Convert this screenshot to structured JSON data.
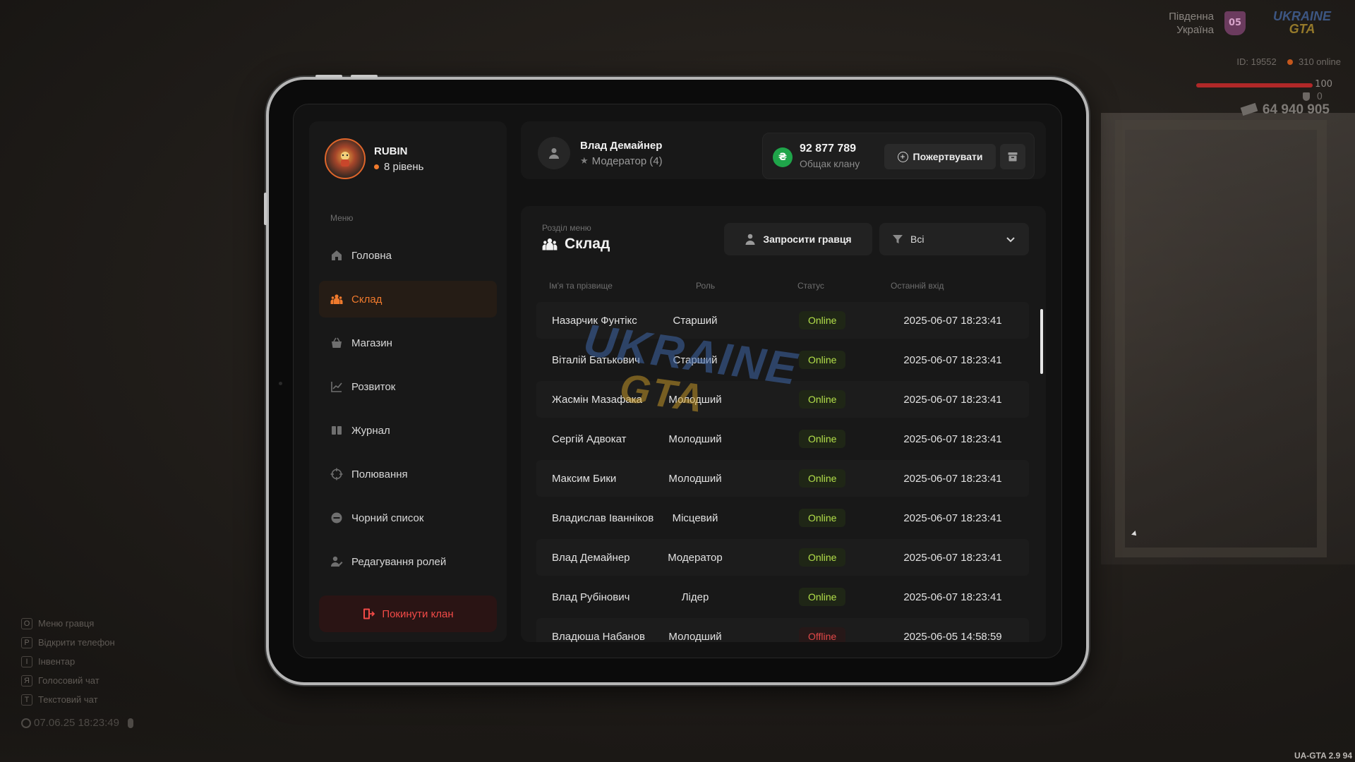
{
  "hud": {
    "region_line1": "Південна",
    "region_line2": "Україна",
    "region_badge": "05",
    "logo_top": "UKRAINE",
    "logo_bottom": "GTA",
    "player_id": "ID: 19552",
    "online": "310 online",
    "health": "100",
    "health_fraction": 1.0,
    "armor": "0",
    "money": "64 940 905",
    "keys": [
      {
        "key": "O",
        "label": "Меню гравця"
      },
      {
        "key": "P",
        "label": "Відкрити телефон"
      },
      {
        "key": "I",
        "label": "Інвентар"
      },
      {
        "key": "Я",
        "label": "Голосовий чат"
      },
      {
        "key": "T",
        "label": "Текстовий чат"
      }
    ],
    "clock": "07.06.25 18:23:49",
    "version": "UA-GTA 2.9   94"
  },
  "sidebar": {
    "clan_name": "RUBIN",
    "clan_level": "8 рівень",
    "menu_title": "Меню",
    "items": [
      {
        "label": "Головна",
        "icon": "home-icon",
        "active": false
      },
      {
        "label": "Склад",
        "icon": "people-icon",
        "active": true
      },
      {
        "label": "Магазин",
        "icon": "shop-icon",
        "active": false
      },
      {
        "label": "Розвиток",
        "icon": "chart-icon",
        "active": false
      },
      {
        "label": "Журнал",
        "icon": "book-icon",
        "active": false
      },
      {
        "label": "Полювання",
        "icon": "crosshair-icon",
        "active": false
      },
      {
        "label": "Чорний список",
        "icon": "block-icon",
        "active": false
      },
      {
        "label": "Редагування ролей",
        "icon": "user-edit-icon",
        "active": false
      }
    ],
    "leave_label": "Покинути клан"
  },
  "header": {
    "user_name": "Влад Демайнер",
    "user_role": "Модератор (4)",
    "treasury_amount": "92 877 789",
    "treasury_label": "Общак клану",
    "currency_symbol": "₴",
    "donate_label": "Пожертвувати"
  },
  "section": {
    "caption": "Розділ меню",
    "title": "Склад",
    "invite_label": "Запросити гравця",
    "filter_value": "Всі"
  },
  "table": {
    "headers": {
      "name": "Ім'я та прізвище",
      "role": "Роль",
      "status": "Статус",
      "last_login": "Останній вхід"
    },
    "rows": [
      {
        "name": "Назарчик Фунтікс",
        "role": "Старший",
        "status": "Online",
        "date": "2025-06-07 18:23:41"
      },
      {
        "name": "Віталій Батькович",
        "role": "Старший",
        "status": "Online",
        "date": "2025-06-07 18:23:41"
      },
      {
        "name": "Жасмін Мазафака",
        "role": "Молодший",
        "status": "Online",
        "date": "2025-06-07 18:23:41"
      },
      {
        "name": "Сергій Адвокат",
        "role": "Молодший",
        "status": "Online",
        "date": "2025-06-07 18:23:41"
      },
      {
        "name": "Максим Бики",
        "role": "Молодший",
        "status": "Online",
        "date": "2025-06-07 18:23:41"
      },
      {
        "name": "Владислав Іванніков",
        "role": "Місцевий",
        "status": "Online",
        "date": "2025-06-07 18:23:41"
      },
      {
        "name": "Влад Демайнер",
        "role": "Модератор",
        "status": "Online",
        "date": "2025-06-07 18:23:41"
      },
      {
        "name": "Влад Рубінович",
        "role": "Лідер",
        "status": "Online",
        "date": "2025-06-07 18:23:41"
      },
      {
        "name": "Владюша Набанов",
        "role": "Молодший",
        "status": "Offline",
        "date": "2025-06-05 14:58:59"
      }
    ]
  },
  "watermark": {
    "top": "UKRAINE",
    "bottom": "GTA"
  },
  "colors": {
    "accent": "#f07a2d",
    "online": "#b3e04a",
    "offline": "#e14848",
    "treasury": "#1fa54a"
  }
}
